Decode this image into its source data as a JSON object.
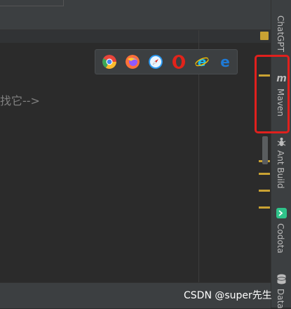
{
  "editor": {
    "code_fragment": "找它-->"
  },
  "browser_toolbar": {
    "items": [
      {
        "name": "chrome-icon",
        "color": "#e8453c"
      },
      {
        "name": "firefox-icon",
        "color": "#ff7139"
      },
      {
        "name": "safari-icon",
        "color": "#2b9af3"
      },
      {
        "name": "opera-icon",
        "color": "#e2231a"
      },
      {
        "name": "internet-explorer-icon",
        "color": "#1ebbee"
      },
      {
        "name": "edge-icon",
        "color": "#1e7ad6"
      }
    ]
  },
  "right_toolwindows": {
    "chatgpt": "ChatGPT",
    "maven": "Maven",
    "ant_build": "Ant Build",
    "codota": "Codota",
    "database": "Data"
  },
  "watermark": "CSDN @super先生",
  "colors": {
    "highlight": "#e0201d",
    "warning": "#c9a233"
  }
}
